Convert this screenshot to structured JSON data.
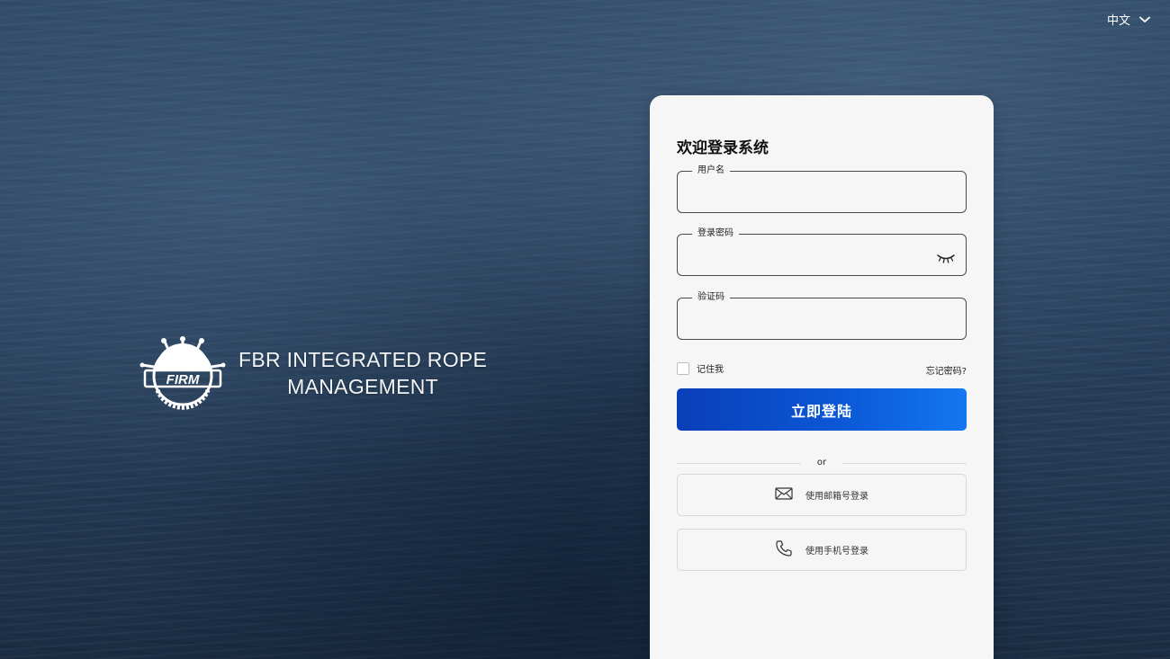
{
  "language": {
    "current": "中文",
    "icon": "chevron-down-icon"
  },
  "brand": {
    "logo_text": "FIRM",
    "name_line1": "FBR INTEGRATED ROPE",
    "name_line2": "MANAGEMENT"
  },
  "login": {
    "title": "欢迎登录系统",
    "username": {
      "label": "用户名",
      "value": ""
    },
    "password": {
      "label": "登录密码",
      "value": "",
      "toggle_icon": "eye-closed-icon"
    },
    "captcha": {
      "label": "验证码",
      "value": ""
    },
    "remember_me": {
      "label": "记住我",
      "checked": false
    },
    "forgot_password": "忘记密码?",
    "submit_label": "立即登陆",
    "divider_text": "or",
    "alt_methods": [
      {
        "label": "使用邮箱号登录",
        "icon": "mail-icon"
      },
      {
        "label": "使用手机号登录",
        "icon": "phone-icon"
      }
    ]
  },
  "colors": {
    "primary_button_start": "#0a3fb8",
    "primary_button_end": "#1477f0",
    "card_background": "#f6f6f6",
    "ocean_background": "#2a4461"
  }
}
